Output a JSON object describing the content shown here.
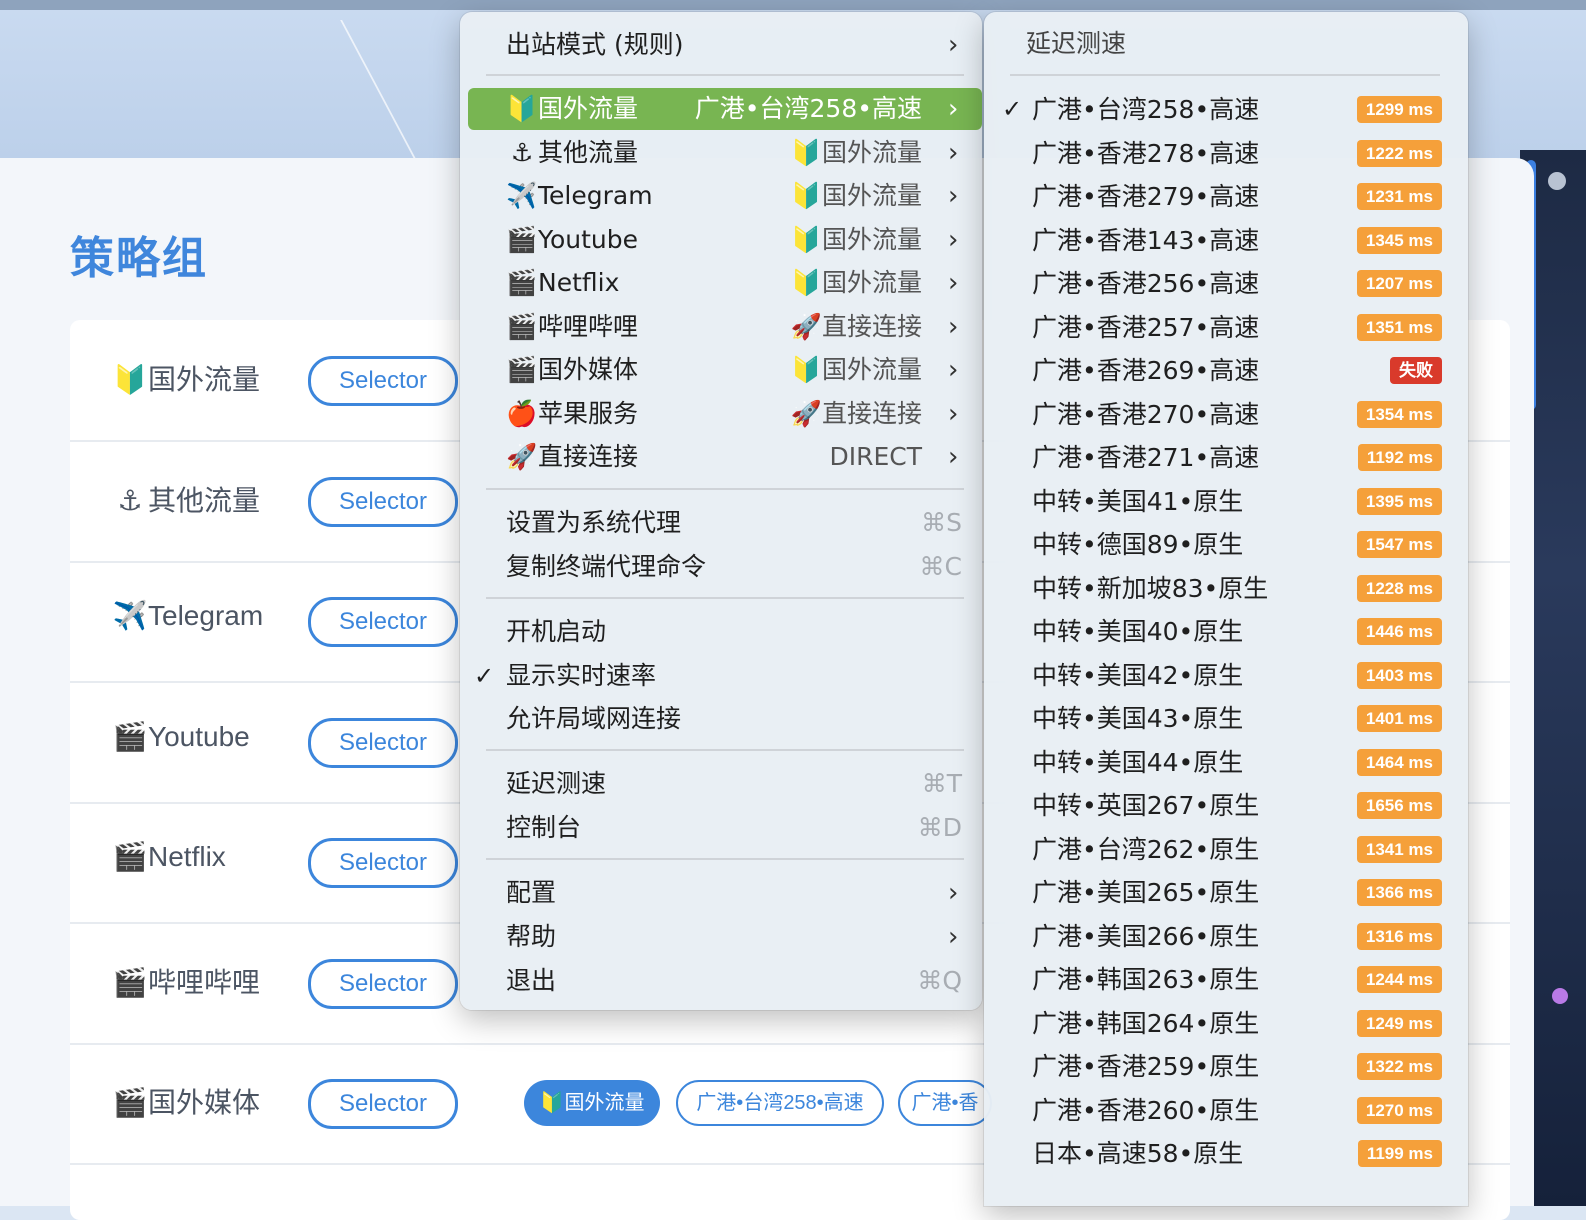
{
  "app": {
    "title": "策略组"
  },
  "groups": [
    {
      "icon": "🔰",
      "name": "国外流量",
      "type": "Selector"
    },
    {
      "icon": "⚓",
      "name": "其他流量",
      "type": "Selector"
    },
    {
      "icon": "✈️",
      "name": "Telegram",
      "type": "Selector"
    },
    {
      "icon": "🎬",
      "name": "Youtube",
      "type": "Selector"
    },
    {
      "icon": "🎬",
      "name": "Netflix",
      "type": "Selector"
    },
    {
      "icon": "🎬",
      "name": "哔哩哔哩",
      "type": "Selector"
    },
    {
      "icon": "🎬",
      "name": "国外媒体",
      "type": "Selector"
    }
  ],
  "group_chips": {
    "active": "🔰国外流量",
    "option1": "广港•台湾258•高速",
    "option2": "广港•香"
  },
  "menu": {
    "mode": "出站模式 (规则)",
    "proxies": [
      {
        "icon": "🔰",
        "name": "国外流量",
        "value": "广港•台湾258•高速",
        "highlighted": true
      },
      {
        "icon": "⚓",
        "name": "其他流量",
        "value": "🔰国外流量"
      },
      {
        "icon": "✈️",
        "name": "Telegram",
        "value": "🔰国外流量"
      },
      {
        "icon": "🎬",
        "name": "Youtube",
        "value": "🔰国外流量"
      },
      {
        "icon": "🎬",
        "name": "Netflix",
        "value": "🔰国外流量"
      },
      {
        "icon": "🎬",
        "name": "哔哩哔哩",
        "value": "🚀直接连接"
      },
      {
        "icon": "🎬",
        "name": "国外媒体",
        "value": "🔰国外流量"
      },
      {
        "icon": "🍎",
        "name": "苹果服务",
        "value": "🚀直接连接"
      },
      {
        "icon": "🚀",
        "name": "直接连接",
        "value": "DIRECT"
      }
    ],
    "set_system_proxy": "设置为系统代理",
    "set_system_proxy_shortcut": "⌘S",
    "copy_terminal": "复制终端代理命令",
    "copy_terminal_shortcut": "⌘C",
    "launch_at_login": "开机启动",
    "show_speed": "显示实时速率",
    "show_speed_checked": true,
    "allow_lan": "允许局域网连接",
    "latency_test": "延迟测速",
    "latency_test_shortcut": "⌘T",
    "dashboard": "控制台",
    "dashboard_shortcut": "⌘D",
    "config": "配置",
    "help": "帮助",
    "quit": "退出",
    "quit_shortcut": "⌘Q"
  },
  "submenu": {
    "title": "延迟测速",
    "nodes": [
      {
        "name": "广港•台湾258•高速",
        "latency": "1299 ms",
        "selected": true,
        "status": "ok"
      },
      {
        "name": "广港•香港278•高速",
        "latency": "1222 ms",
        "status": "ok"
      },
      {
        "name": "广港•香港279•高速",
        "latency": "1231 ms",
        "status": "ok"
      },
      {
        "name": "广港•香港143•高速",
        "latency": "1345 ms",
        "status": "ok"
      },
      {
        "name": "广港•香港256•高速",
        "latency": "1207 ms",
        "status": "ok"
      },
      {
        "name": "广港•香港257•高速",
        "latency": "1351 ms",
        "status": "ok"
      },
      {
        "name": "广港•香港269•高速",
        "latency": "失败",
        "status": "fail"
      },
      {
        "name": "广港•香港270•高速",
        "latency": "1354 ms",
        "status": "ok"
      },
      {
        "name": "广港•香港271•高速",
        "latency": "1192 ms",
        "status": "ok"
      },
      {
        "name": " 中转•美国41•原生",
        "latency": "1395 ms",
        "status": "ok"
      },
      {
        "name": "中转•德国89•原生",
        "latency": "1547 ms",
        "status": "ok"
      },
      {
        "name": "中转•新加坡83•原生",
        "latency": "1228 ms",
        "status": "ok"
      },
      {
        "name": "中转•美国40•原生",
        "latency": "1446 ms",
        "status": "ok"
      },
      {
        "name": "中转•美国42•原生",
        "latency": "1403 ms",
        "status": "ok"
      },
      {
        "name": "中转•美国43•原生",
        "latency": "1401 ms",
        "status": "ok"
      },
      {
        "name": "中转•美国44•原生",
        "latency": "1464 ms",
        "status": "ok"
      },
      {
        "name": "中转•英国267•原生",
        "latency": "1656 ms",
        "status": "ok"
      },
      {
        "name": "广港•台湾262•原生",
        "latency": "1341 ms",
        "status": "ok"
      },
      {
        "name": "广港•美国265•原生",
        "latency": "1366 ms",
        "status": "ok"
      },
      {
        "name": "广港•美国266•原生",
        "latency": "1316 ms",
        "status": "ok"
      },
      {
        "name": "广港•韩国263•原生",
        "latency": "1244 ms",
        "status": "ok"
      },
      {
        "name": "广港•韩国264•原生",
        "latency": "1249 ms",
        "status": "ok"
      },
      {
        "name": "广港•香港259•原生",
        "latency": "1322 ms",
        "status": "ok"
      },
      {
        "name": "广港•香港260•原生",
        "latency": "1270 ms",
        "status": "ok"
      },
      {
        "name": "日本•高速58•原生",
        "latency": "1199 ms",
        "status": "ok"
      }
    ]
  },
  "colors": {
    "accent": "#3c86dc",
    "highlight": "#78b552",
    "latency_ok": "#f5a03a",
    "latency_fail": "#d93a2b"
  },
  "icons": {
    "chevron": "chevron-right-icon",
    "check": "checkmark-icon"
  }
}
